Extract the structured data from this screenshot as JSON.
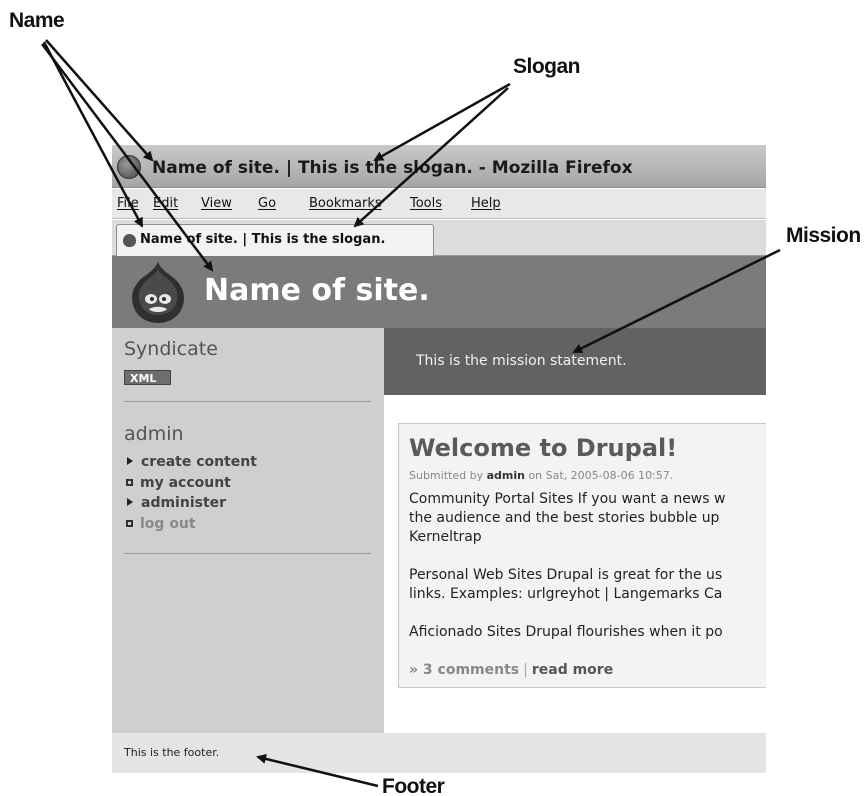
{
  "callouts": {
    "name": "Name",
    "slogan": "Slogan",
    "mission": "Mission",
    "footer": "Footer"
  },
  "window": {
    "title": "Name of site.  | This is the slogan. - Mozilla Firefox"
  },
  "menubar": [
    "File",
    "Edit",
    "View",
    "Go",
    "Bookmarks",
    "Tools",
    "Help"
  ],
  "tab": {
    "label": "Name of site. | This is the slogan."
  },
  "header": {
    "site_name": "Name of site."
  },
  "mission": {
    "text": "This is the mission statement."
  },
  "sidebar": {
    "syndicate": {
      "title": "Syndicate",
      "badge": "XML"
    },
    "user_block": {
      "title": "admin",
      "items": [
        {
          "label": "create content",
          "bullet": "arrow"
        },
        {
          "label": "my account",
          "bullet": "box"
        },
        {
          "label": "administer",
          "bullet": "arrow"
        },
        {
          "label": "log out",
          "bullet": "box"
        }
      ]
    }
  },
  "node": {
    "title": "Welcome to Drupal!",
    "submitted_prefix": "Submitted by",
    "author": "admin",
    "date_text": "on Sat, 2005-08-06 10:57.",
    "paragraphs": [
      "Community Portal Sites If you want a news w",
      "the audience and the best stories bubble up",
      "Kerneltrap",
      "Personal Web Sites Drupal is great for the us",
      "links. Examples: urlgreyhot | Langemarks Ca",
      "Aficionado Sites Drupal flourishes when it po"
    ],
    "comments_link": "» 3 comments",
    "separator": "|",
    "read_more": "read more"
  },
  "footer": {
    "text": "This is the footer."
  },
  "colors": {
    "header_bg": "#7b7b7b",
    "mission_bg": "#626262",
    "sidebar_bg": "#cfcfcf",
    "footer_bg": "#e4e4e4"
  }
}
